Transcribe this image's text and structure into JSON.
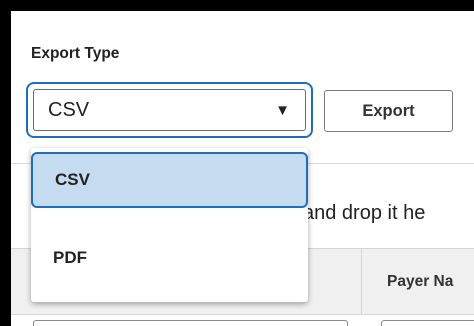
{
  "export": {
    "label": "Export Type",
    "selected_value": "CSV",
    "caret": "▼",
    "button_label": "Export",
    "options": [
      "CSV",
      "PDF"
    ]
  },
  "upload": {
    "drop_text": "and drop it he"
  },
  "grid": {
    "column_payer": "Payer Na"
  },
  "colors": {
    "focus_blue": "#1e6fb8",
    "selected_bg": "#c5dbef",
    "header_bg": "#f0f0f0"
  }
}
